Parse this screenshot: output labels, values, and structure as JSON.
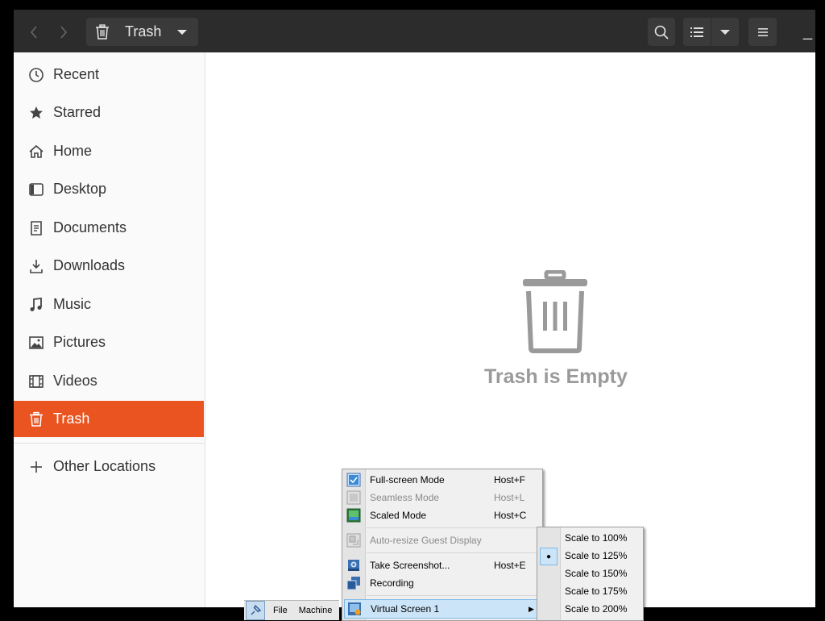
{
  "header": {
    "location_label": "Trash",
    "back_icon": "chevron-left-icon",
    "forward_icon": "chevron-right-icon",
    "search_icon": "search-icon",
    "view_icon": "list-view-icon",
    "view_options_icon": "chevron-down-icon",
    "menu_icon": "hamburger-menu-icon",
    "minimize_label": "_"
  },
  "sidebar": {
    "items": [
      {
        "label": "Recent",
        "icon": "clock-icon"
      },
      {
        "label": "Starred",
        "icon": "star-icon"
      },
      {
        "label": "Home",
        "icon": "home-icon"
      },
      {
        "label": "Desktop",
        "icon": "desktop-icon"
      },
      {
        "label": "Documents",
        "icon": "document-icon"
      },
      {
        "label": "Downloads",
        "icon": "download-icon"
      },
      {
        "label": "Music",
        "icon": "music-icon"
      },
      {
        "label": "Pictures",
        "icon": "picture-icon"
      },
      {
        "label": "Videos",
        "icon": "video-icon"
      },
      {
        "label": "Trash",
        "icon": "trash-icon",
        "active": true
      }
    ],
    "other_locations": "Other Locations"
  },
  "main": {
    "empty_message": "Trash is Empty"
  },
  "vm_bar": {
    "file_label": "File",
    "machine_label": "Machine"
  },
  "view_menu": {
    "items": [
      {
        "label": "Full-screen Mode",
        "shortcut": "Host+F",
        "enabled": true
      },
      {
        "label": "Seamless Mode",
        "shortcut": "Host+L",
        "enabled": false
      },
      {
        "label": "Scaled Mode",
        "shortcut": "Host+C",
        "enabled": true
      },
      {
        "label": "Auto-resize Guest Display",
        "shortcut": "",
        "enabled": false
      },
      {
        "label": "Take Screenshot...",
        "shortcut": "Host+E",
        "enabled": true
      },
      {
        "label": "Recording",
        "shortcut": "",
        "enabled": true
      },
      {
        "label": "Virtual Screen 1",
        "shortcut": "",
        "enabled": true,
        "submenu": true
      }
    ]
  },
  "scale_submenu": {
    "items": [
      {
        "label": "Scale to 100%",
        "selected": false
      },
      {
        "label": "Scale to 125%",
        "selected": true
      },
      {
        "label": "Scale to 150%",
        "selected": false
      },
      {
        "label": "Scale to 175%",
        "selected": false
      },
      {
        "label": "Scale to 200%",
        "selected": false
      }
    ]
  },
  "colors": {
    "headerbar": "#2c2c2c",
    "accent": "#e95420",
    "sidebar_bg": "#fafafa",
    "menu_highlight": "#cce4f7"
  }
}
